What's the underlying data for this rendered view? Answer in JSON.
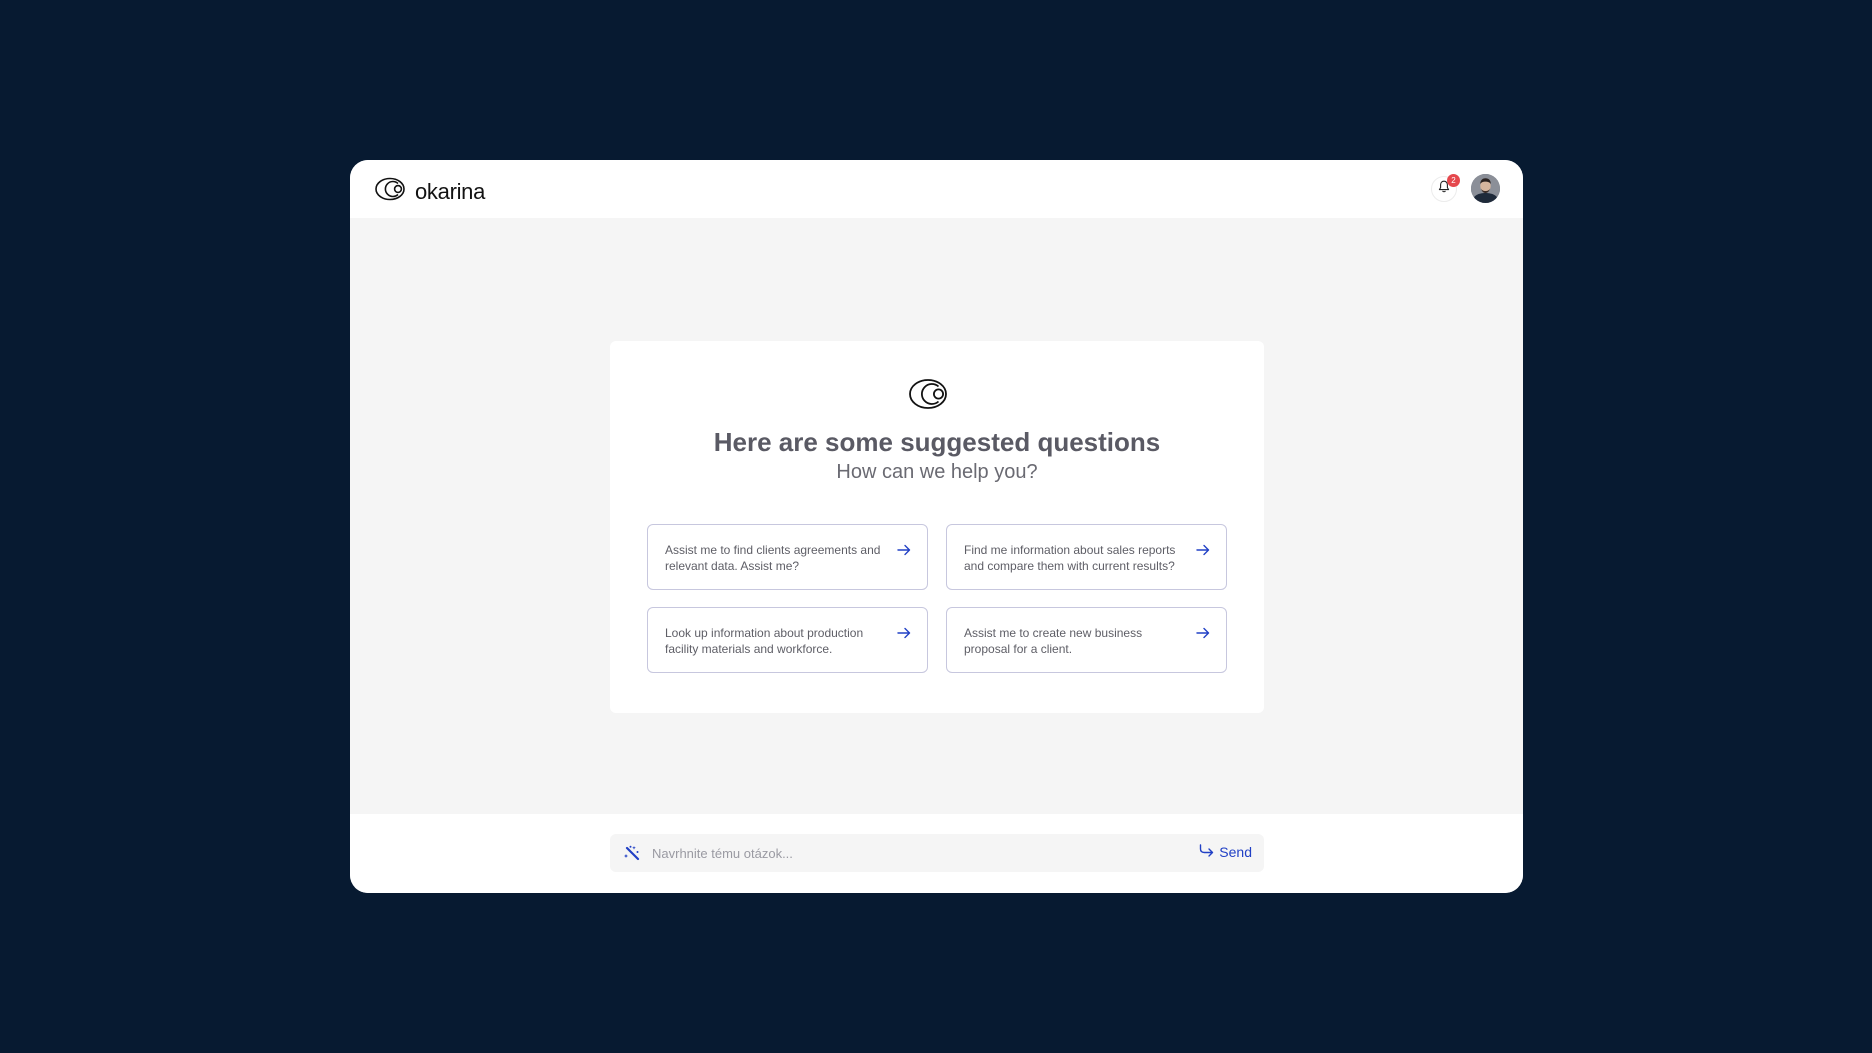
{
  "brand": {
    "name": "okarina",
    "logo_icon": "okarina-logo-icon"
  },
  "header": {
    "notifications_icon": "bell-icon",
    "notifications_count": "2",
    "avatar_icon": "user-avatar"
  },
  "suggestions": {
    "title": "Here are some suggested questions",
    "subtitle": "How can we help you?",
    "items": [
      {
        "text": "Assist me to find clients agreements and relevant data. Assist me?",
        "icon": "arrow-right-icon"
      },
      {
        "text": "Find me information about sales reports and compare them with current results?",
        "icon": "arrow-right-icon"
      },
      {
        "text": "Look up information about production facility materials and workforce.",
        "icon": "arrow-right-icon"
      },
      {
        "text": "Assist me to create new business proposal for a client.",
        "icon": "arrow-right-icon"
      }
    ]
  },
  "composer": {
    "placeholder": "Navrhnite tému otázok...",
    "value": "",
    "send_label": "Send",
    "wand_icon": "magic-wand-icon",
    "send_icon": "send-arrow-icon"
  },
  "colors": {
    "page_background": "#071a31",
    "accent": "#2140c5",
    "badge": "#e5484d",
    "card_border": "#c7c7de"
  }
}
